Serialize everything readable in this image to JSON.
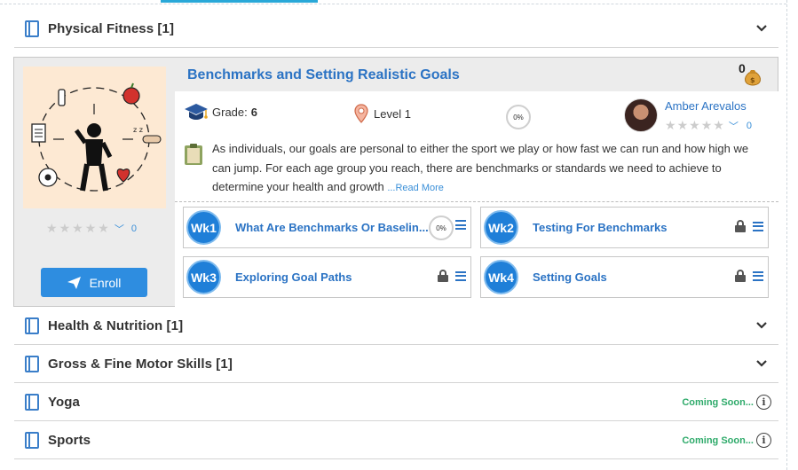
{
  "categories": [
    {
      "title": "Physical Fitness [1]",
      "status": "expanded"
    },
    {
      "title": "Health & Nutrition [1]",
      "status": "collapsed"
    },
    {
      "title": "Gross & Fine Motor Skills [1]",
      "status": "collapsed"
    },
    {
      "title": "Yoga",
      "status": "coming_soon",
      "coming_label": "Coming Soon..."
    },
    {
      "title": "Sports",
      "status": "coming_soon",
      "coming_label": "Coming Soon..."
    }
  ],
  "course": {
    "title": "Benchmarks and Setting Realistic Goals",
    "money_count": "0",
    "grade_label": "Grade:",
    "grade_value": "6",
    "level": "Level 1",
    "progress": "0%",
    "author": {
      "name": "Amber Arevalos",
      "rating_count": "0"
    },
    "rating_count": "0",
    "description": "As individuals, our goals are personal to either the sport we play or how fast we can run and how high we can jump. For each age group you reach, there are benchmarks or standards we need to achieve to determine your health and growth",
    "read_more": "...Read More",
    "enroll_label": "Enroll",
    "weeks": [
      {
        "badge": "Wk1",
        "title": "What Are Benchmarks Or Baselin...",
        "progress": "0%",
        "locked": false
      },
      {
        "badge": "Wk2",
        "title": "Testing For Benchmarks",
        "locked": true
      },
      {
        "badge": "Wk3",
        "title": "Exploring Goal Paths",
        "locked": true
      },
      {
        "badge": "Wk4",
        "title": "Setting Goals",
        "locked": true
      }
    ]
  },
  "icons": {
    "category": "book-icon",
    "expand": "chevron-down-icon",
    "info": "info-icon",
    "grade": "graduation-cap-icon",
    "level": "map-pin-icon",
    "description": "clipboard-icon",
    "money": "money-bag-icon",
    "lock": "lock-icon",
    "menu": "menu-icon",
    "enroll": "paper-plane-icon",
    "star": "star-icon"
  },
  "colors": {
    "link": "#2b73c4",
    "accent": "#29a8d8",
    "button": "#2e8de0",
    "coming_soon": "#2eaa6a",
    "week_badge": "#1f7fd8"
  }
}
